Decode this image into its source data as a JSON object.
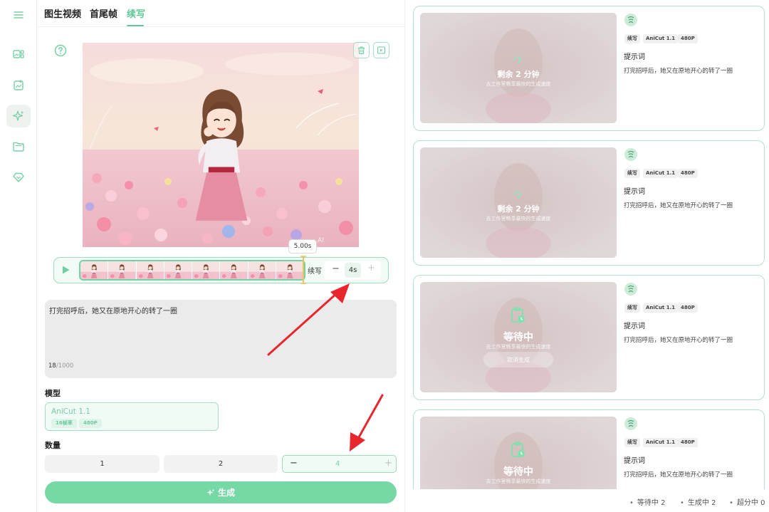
{
  "tabs": [
    {
      "label": "图生视频"
    },
    {
      "label": "首尾帧"
    },
    {
      "label": "续写"
    }
  ],
  "sidebar": {
    "items": [
      {
        "icon": "menu-icon"
      },
      {
        "icon": "image-grid-icon"
      },
      {
        "icon": "image-add-icon"
      },
      {
        "icon": "sparkle-icon",
        "active": true
      },
      {
        "icon": "folder-icon"
      },
      {
        "icon": "diamond-icon"
      }
    ]
  },
  "preview": {
    "watermark": "AI"
  },
  "timeline": {
    "duration_label": "5.00s",
    "continue_label": "续写",
    "extend_value": "4s",
    "minus": "−",
    "plus": "+",
    "frame_count": 8
  },
  "prompt": {
    "text": "打完招呼后，她又在原地开心的转了一圈",
    "count": "18",
    "max": "/1000"
  },
  "model": {
    "section_label": "模型",
    "name": "AniCut 1.1",
    "tags": [
      "16帧率",
      "480P"
    ]
  },
  "quantity": {
    "section_label": "数量",
    "options": [
      "1",
      "2"
    ],
    "value": "4",
    "minus": "−",
    "plus": "+"
  },
  "generate": {
    "label": "生成"
  },
  "tasks": [
    {
      "status_title": "剩余 2 分钟",
      "status_sub": "去工作室畅享最快的生成速度",
      "kind": "progress",
      "tags": [
        "续写",
        "AniCut 1.1",
        "480P"
      ],
      "prompt_label": "提示词",
      "prompt": "打完招呼后，她又在原地开心的转了一圈"
    },
    {
      "status_title": "剩余 2 分钟",
      "status_sub": "去工作室畅享最快的生成速度",
      "kind": "progress",
      "tags": [
        "续写",
        "AniCut 1.1",
        "480P"
      ],
      "prompt_label": "提示词",
      "prompt": "打完招呼后，她又在原地开心的转了一圈"
    },
    {
      "status_title": "等待中",
      "status_sub": "去工作室畅享最快的生成速度",
      "kind": "waiting",
      "cancel_label": "取消生成",
      "tags": [
        "续写",
        "AniCut 1.1",
        "480P"
      ],
      "prompt_label": "提示词",
      "prompt": "打完招呼后，她又在原地开心的转了一圈"
    },
    {
      "status_title": "等待中",
      "status_sub": "去工作室畅享最快的生成速度",
      "kind": "waiting",
      "tags": [
        "续写",
        "AniCut 1.1",
        "480P"
      ],
      "prompt_label": "提示词",
      "prompt": "打完招呼后，她又在原地开心的转了一圈"
    }
  ],
  "status_bar": {
    "waiting": "等待中 2",
    "generating": "生成中 2",
    "upscaling": "超分中 0"
  },
  "colors": {
    "accent": "#5cc896",
    "accent_light": "#76d8a5",
    "annotation_arrow": "#e8262b"
  }
}
